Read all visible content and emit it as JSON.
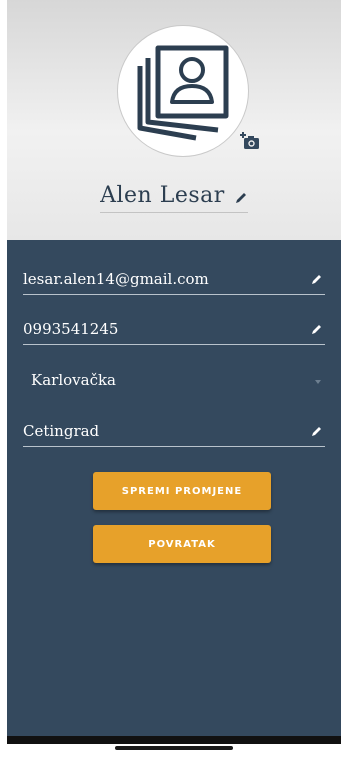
{
  "profile": {
    "name": "Alen Lesar",
    "avatar_icon": "person-photo-placeholder-icon",
    "camera_icon": "add-photo-camera-icon",
    "edit_icon": "pencil-icon"
  },
  "fields": {
    "email": "lesar.alen14@gmail.com",
    "phone": "0993541245",
    "county": "Karlovačka",
    "city": "Cetingrad"
  },
  "buttons": {
    "save_label": "SPREMI PROMJENE",
    "back_label": "POVRATAK"
  },
  "colors": {
    "panel": "#34495e",
    "accent": "#e7a12a",
    "header": "#eeeeee"
  }
}
